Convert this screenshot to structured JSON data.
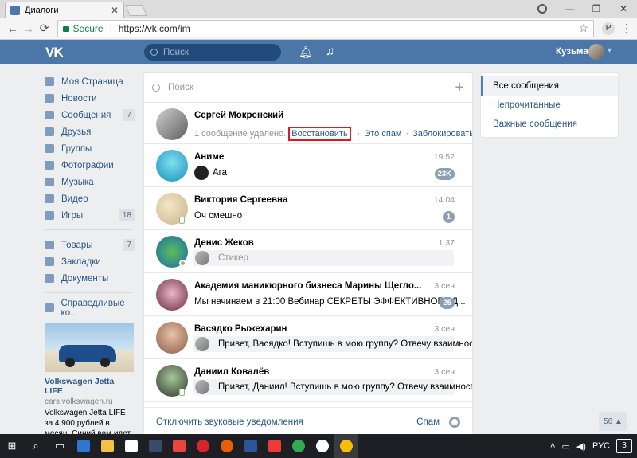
{
  "browser": {
    "tab_title": "Диалоги",
    "secure_label": "Secure",
    "url": "https://vk.com/im",
    "extension_label": "P"
  },
  "header": {
    "logo": "VK",
    "search_placeholder": "Поиск",
    "user_name": "Кузьма"
  },
  "left_menu": {
    "items": [
      {
        "label": "Моя Страница",
        "badge": ""
      },
      {
        "label": "Новости",
        "badge": ""
      },
      {
        "label": "Сообщения",
        "badge": "7"
      },
      {
        "label": "Друзья",
        "badge": ""
      },
      {
        "label": "Группы",
        "badge": ""
      },
      {
        "label": "Фотографии",
        "badge": ""
      },
      {
        "label": "Музыка",
        "badge": ""
      },
      {
        "label": "Видео",
        "badge": ""
      },
      {
        "label": "Игры",
        "badge": "18"
      }
    ],
    "items2": [
      {
        "label": "Товары",
        "badge": "7"
      },
      {
        "label": "Закладки",
        "badge": ""
      },
      {
        "label": "Документы",
        "badge": ""
      }
    ],
    "items3": [
      {
        "label": "Справедливые ко..",
        "badge": ""
      }
    ],
    "ad": {
      "title": "Volkswagen Jetta LIFE",
      "site": "cars.volkswagen.ru",
      "text": "Volkswagen Jetta LIFE за 4 900 рублей в месяц. Синий вам идет"
    }
  },
  "dialogs": {
    "search_placeholder": "Поиск",
    "deleted_dialog": {
      "name": "Сергей Мокренский",
      "deleted_text": "1 сообщение удалено.",
      "restore": "Восстановить",
      "spam": "Это спам",
      "block": "Заблокировать"
    },
    "rows": [
      {
        "name": "Аниме",
        "time": "19:52",
        "preview": "Ага",
        "unread": "23K"
      },
      {
        "name": "Виктория Сергеевна",
        "time": "14:04",
        "preview": "Оч смешно",
        "unread": "1"
      },
      {
        "name": "Денис Жеков",
        "time": "1:37",
        "preview": "Стикер",
        "unread": ""
      },
      {
        "name": "Академия маникюрного бизнеса Марины Щегло...",
        "time": "3 сен",
        "preview": "Мы начинаем в 21:00 Вебинар СЕКРЕТЫ ЭФФЕКТИВНОГО Д...",
        "unread": "25"
      },
      {
        "name": "Васядко Рыжехарин",
        "time": "3 сен",
        "preview": "Привет, Васядко! Вступишь в мою группу? Отвечу взаимность...",
        "unread": ""
      },
      {
        "name": "Даниил Ковалёв",
        "time": "3 сен",
        "preview": "Привет, Даниил! Вступишь в мою группу? Отвечу взаимность...",
        "unread": ""
      }
    ],
    "footer": {
      "mute": "Отключить звуковые уведомления",
      "spam": "Спам"
    }
  },
  "right_menu": {
    "items": [
      "Все сообщения",
      "Непрочитанные",
      "Важные сообщения"
    ]
  },
  "minichat_count": "56",
  "taskbar": {
    "lang": "РУС",
    "notif_count": "3"
  },
  "colors": {
    "vk_blue": "#4a76a8",
    "link": "#2a5885",
    "highlight_border": "#e0171d"
  }
}
